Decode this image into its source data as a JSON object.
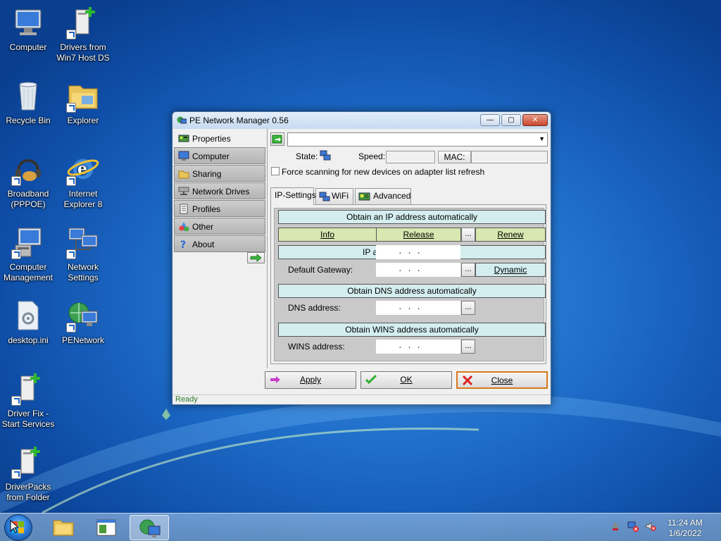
{
  "desktop": {
    "icons": [
      {
        "label": "Computer"
      },
      {
        "label": "Drivers from Win7 Host DS"
      },
      {
        "label": "Recycle Bin"
      },
      {
        "label": "Explorer"
      },
      {
        "label": "Broadband (PPPOE)"
      },
      {
        "label": "Internet Explorer 8"
      },
      {
        "label": "Computer Management"
      },
      {
        "label": "Network Settings"
      },
      {
        "label": "desktop.ini"
      },
      {
        "label": "PENetwork"
      },
      {
        "label": "Driver Fix - Start Services"
      },
      {
        "label": "DriverPacks from Folder"
      }
    ]
  },
  "window": {
    "title": "PE Network Manager 0.56",
    "controls": {
      "minimize": "—",
      "maximize": "▢",
      "close": "✕"
    },
    "menu": [
      {
        "label": "Properties",
        "icon": "network-card-icon",
        "active": true
      },
      {
        "label": "Computer",
        "icon": "monitor-icon",
        "active": false
      },
      {
        "label": "Sharing",
        "icon": "sharing-icon",
        "active": false
      },
      {
        "label": "Network Drives",
        "icon": "network-drive-icon",
        "active": false
      },
      {
        "label": "Profiles",
        "icon": "profiles-icon",
        "active": false
      },
      {
        "label": "Other",
        "icon": "shapes-icon",
        "active": false
      },
      {
        "label": "About",
        "icon": "help-icon",
        "active": false
      }
    ],
    "adapter_select": {
      "value": ""
    },
    "state_label": "State:",
    "speed_label": "Speed:",
    "speed_value": "",
    "mac_label": "MAC:",
    "mac_value": "",
    "force_scan": {
      "label": "Force scanning for new devices on adapter list refresh",
      "checked": false
    },
    "tabs": [
      {
        "label": "IP-Settings",
        "active": true
      },
      {
        "label": "WiFi",
        "active": false
      },
      {
        "label": "Advanced",
        "active": false
      }
    ],
    "ip_settings": {
      "obtain_ip": "Obtain an IP address automatically",
      "info": "Info",
      "release": "Release",
      "dots": "...",
      "renew": "Renew",
      "ip_prefix": "IP a",
      "ip_value": ".   .   .",
      "gateway_label": "Default Gateway:",
      "gateway_value": ".   .   .",
      "dynamic": "Dynamic",
      "obtain_dns": "Obtain DNS address automatically",
      "dns_label": "DNS address:",
      "dns_value": ".   .   .",
      "obtain_wins": "Obtain WINS address automatically",
      "wins_label": "WINS address:",
      "wins_value": ".   .   ."
    },
    "buttons": {
      "apply": "Apply",
      "ok": "OK",
      "close": "Close"
    },
    "status": "Ready"
  },
  "taskbar": {
    "clock_time": "11:24 AM",
    "clock_date": "1/6/2022"
  },
  "colors": {
    "bar_teal": "#d4eef0",
    "btn_green": "#d8e8b0",
    "status_green": "#2a7a2a",
    "close_orange": "#d8781a"
  }
}
